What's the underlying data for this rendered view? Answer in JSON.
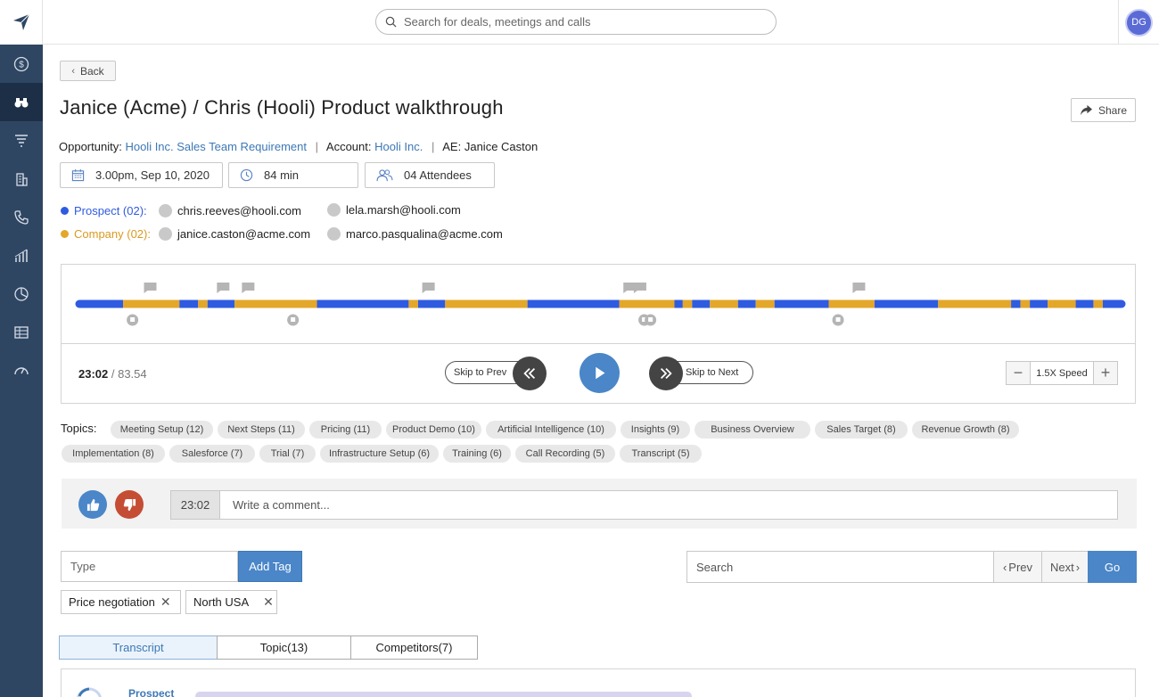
{
  "search": {
    "placeholder": "Search for deals, meetings and calls"
  },
  "user": {
    "initials": "DG"
  },
  "back_label": "Back",
  "title": "Janice (Acme) / Chris (Hooli) Product walkthrough",
  "share_label": "Share",
  "meta": {
    "opportunity_label": "Opportunity:",
    "opportunity_value": "Hooli Inc. Sales Team Requirement",
    "account_label": "Account:",
    "account_value": "Hooli Inc.",
    "ae_label": "AE:",
    "ae_value": "Janice Caston",
    "separator": "|"
  },
  "chips": {
    "date": "3.00pm, Sep 10, 2020",
    "duration": "84 min",
    "attendees": "04 Attendees"
  },
  "prospect": {
    "label": "Prospect (02):",
    "color": "#2f5be0",
    "people": [
      "chris.reeves@hooli.com",
      "lela.marsh@hooli.com"
    ]
  },
  "company": {
    "label": "Company (02):",
    "color": "#e3a72a",
    "people": [
      "janice.caston@acme.com",
      "marco.pasqualina@acme.com"
    ]
  },
  "player": {
    "current": "23:02",
    "total": "83.54",
    "skip_prev": "Skip to Prev",
    "skip_next": "Skip to Next",
    "speed": "1.5X Speed",
    "segments": [
      [
        "b",
        0,
        4.2
      ],
      [
        "y",
        4.2,
        9.6
      ],
      [
        "b",
        9.6,
        11.4
      ],
      [
        "y",
        11.4,
        12.3
      ],
      [
        "b",
        12.3,
        14.9
      ],
      [
        "y",
        14.9,
        22.8
      ],
      [
        "b",
        22.8,
        31.6
      ],
      [
        "y",
        31.6,
        32.5
      ],
      [
        "b",
        32.5,
        35.1
      ],
      [
        "y",
        35.1,
        43.0
      ],
      [
        "b",
        43.0,
        51.8
      ],
      [
        "y",
        51.8,
        57.1
      ],
      [
        "b",
        57.1,
        57.9
      ],
      [
        "y",
        57.9,
        58.8
      ],
      [
        "b",
        58.8,
        60.5
      ],
      [
        "y",
        60.5,
        63.2
      ],
      [
        "b",
        63.2,
        64.9
      ],
      [
        "y",
        64.9,
        66.7
      ],
      [
        "b",
        66.7,
        71.9
      ],
      [
        "y",
        71.9,
        76.3
      ],
      [
        "b",
        76.3,
        82.4
      ],
      [
        "y",
        82.4,
        89.4
      ],
      [
        "b",
        89.4,
        90.3
      ],
      [
        "y",
        90.3,
        91.2
      ],
      [
        "b",
        91.2,
        92.9
      ],
      [
        "y",
        92.9,
        95.6
      ],
      [
        "b",
        95.6,
        97.3
      ],
      [
        "y",
        97.3,
        98.2
      ],
      [
        "b",
        98.2,
        100
      ]
    ],
    "comment_markers": [
      6.8,
      13.8,
      16.2,
      33.5,
      52.8,
      53.8,
      74.8
    ],
    "reaction_markers": [
      5.1,
      20.5,
      54.2,
      54.8,
      72.8
    ]
  },
  "topics": {
    "label": "Topics:",
    "items": [
      "Meeting Setup (12)",
      "Next Steps (11)",
      "Pricing (11)",
      "Product Demo (10)",
      "Artificial Intelligence (10)",
      "Insights (9)",
      "Business Overview",
      "Sales Target (8)",
      "Revenue Growth (8)",
      "Implementation (8)",
      "Salesforce (7)",
      "Trial (7)",
      "Infrastructure Setup (6)",
      "Training (6)",
      "Call Recording (5)",
      "Transcript (5)"
    ]
  },
  "comment": {
    "time": "23:02",
    "placeholder": "Write a comment..."
  },
  "tags": {
    "placeholder": "Type",
    "add_label": "Add Tag",
    "items": [
      "Price negotiation",
      "North USA"
    ],
    "remove_glyph": "✕"
  },
  "transcript_search": {
    "placeholder": "Search",
    "prev": "Prev",
    "next": "Next",
    "go": "Go"
  },
  "tabs": [
    "Transcript",
    "Topic(13)",
    "Competitors(7)"
  ],
  "transcript_first": {
    "speaker": "Prospect"
  }
}
